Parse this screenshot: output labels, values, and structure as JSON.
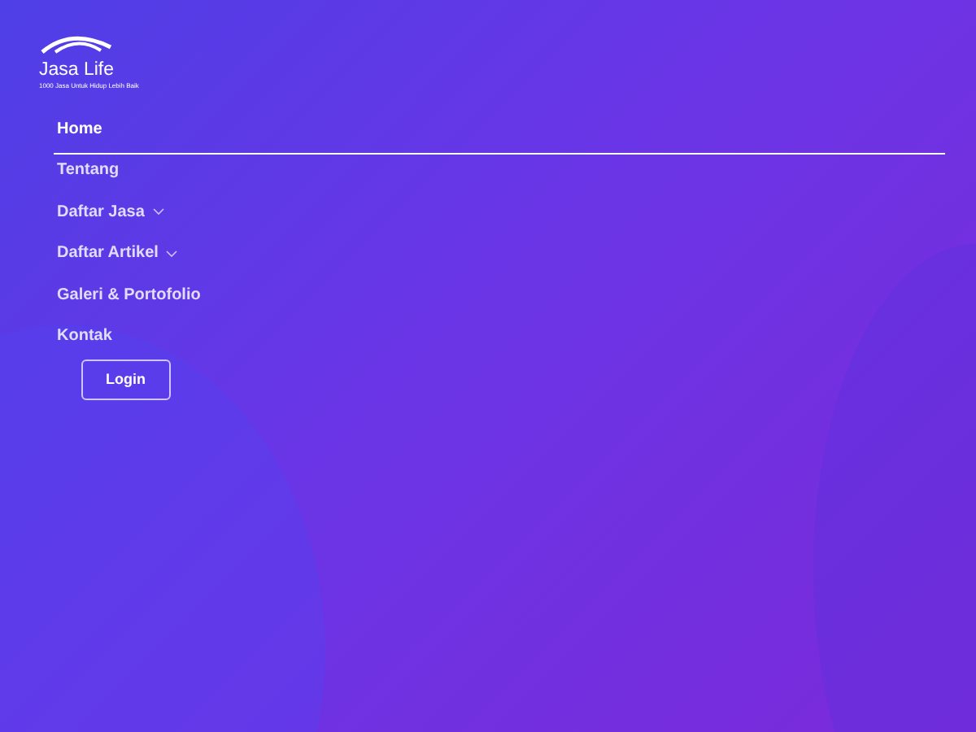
{
  "logo": {
    "name": "Jasa Life",
    "tagline": "1000 Jasa Untuk Hidup Lebih Baik"
  },
  "nav": [
    {
      "label": "Home",
      "selected": true,
      "dropdown": false
    },
    {
      "label": "Tentang",
      "selected": false,
      "dropdown": false
    },
    {
      "label": "Daftar Jasa",
      "selected": false,
      "dropdown": true
    },
    {
      "label": "Daftar Artikel",
      "selected": false,
      "dropdown": true
    },
    {
      "label": "Galeri & Portofolio",
      "selected": false,
      "dropdown": false
    },
    {
      "label": "Kontak",
      "selected": false,
      "dropdown": false
    }
  ],
  "login_button": "Login"
}
